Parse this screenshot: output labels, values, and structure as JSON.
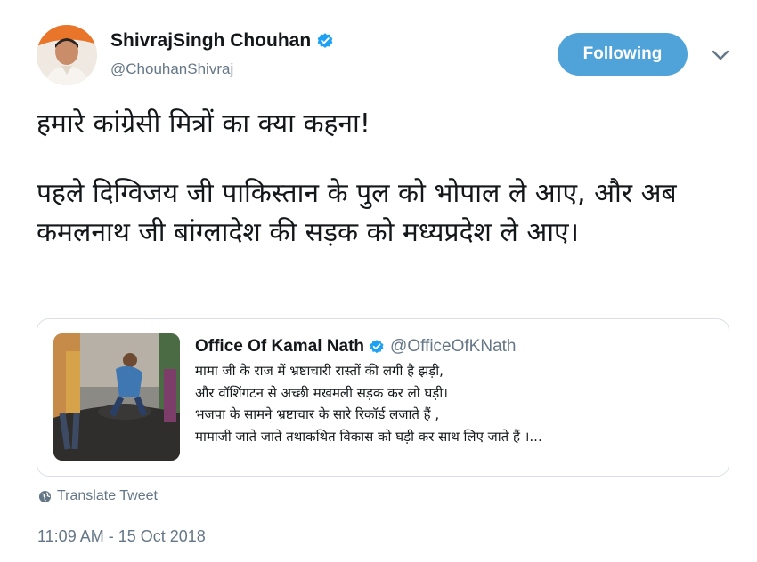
{
  "author": {
    "display_name": "ShivrajSingh Chouhan",
    "handle": "@ChouhanShivraj",
    "avatar_icon": "profile-photo",
    "verified_icon": "verified-badge-icon"
  },
  "follow_button": {
    "label": "Following",
    "color": "#4fa3d8"
  },
  "menu_icon": "chevron-down-icon",
  "tweet": {
    "paragraphs": [
      "हमारे कांग्रेसी मित्रों का क्या कहना!",
      "पहले दिग्विजय जी पाकिस्तान के पुल को भोपाल ले आए, और अब कमलनाथ जी बांग्लादेश की सड़क को मध्यप्रदेश ले आए।"
    ]
  },
  "quoted_tweet": {
    "display_name": "Office Of Kamal Nath",
    "handle": "@OfficeOfKNath",
    "lines": [
      "मामा जी के राज में भ्रष्टाचारी रास्तों की लगी है झड़ी,",
      "और वॉशिंगटन से  अच्छी मखमली सड़क कर लो घड़ी।",
      "भजपा के सामने भ्रष्टाचार के सारे रिकॉर्ड लजाते हैं ,",
      "मामाजी जाते जाते तथाकथित विकास को घड़ी कर साथ लिए जाते हैं ।..."
    ]
  },
  "translate_label": "Translate Tweet",
  "timestamp": "11:09 AM - 15 Oct 2018"
}
